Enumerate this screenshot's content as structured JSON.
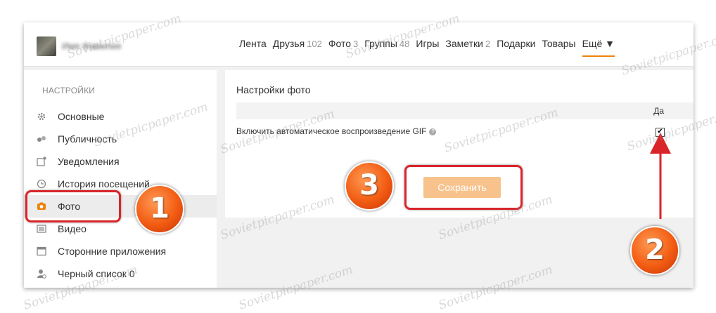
{
  "header": {
    "username": "Имя Фамилия",
    "nav": [
      {
        "label": "Лента",
        "count": ""
      },
      {
        "label": "Друзья",
        "count": "102"
      },
      {
        "label": "Фото",
        "count": "3"
      },
      {
        "label": "Группы",
        "count": "48"
      },
      {
        "label": "Игры",
        "count": ""
      },
      {
        "label": "Заметки",
        "count": "2"
      },
      {
        "label": "Подарки",
        "count": ""
      },
      {
        "label": "Товары",
        "count": ""
      },
      {
        "label": "Ещё ▼",
        "count": ""
      }
    ]
  },
  "sidebar": {
    "title": "НАСТРОЙКИ",
    "items": [
      {
        "label": "Основные",
        "icon": "gear-icon"
      },
      {
        "label": "Публичность",
        "icon": "visibility-icon"
      },
      {
        "label": "Уведомления",
        "icon": "notification-icon"
      },
      {
        "label": "История посещений",
        "icon": "history-icon"
      },
      {
        "label": "Фото",
        "icon": "camera-icon"
      },
      {
        "label": "Видео",
        "icon": "video-icon"
      },
      {
        "label": "Сторонние приложения",
        "icon": "apps-icon"
      },
      {
        "label": "Черный список",
        "icon": "blacklist-icon",
        "count": "0"
      }
    ]
  },
  "main": {
    "title": "Настройки фото",
    "column_yes": "Да",
    "setting_gif": "Включить автоматическое воспроизведение GIF",
    "gif_checked": true,
    "save_label": "Сохранить"
  },
  "annotations": {
    "badge1": "1",
    "badge2": "2",
    "badge3": "3",
    "color": "#d9252a"
  },
  "watermark": "Sovietpicpaper.com"
}
